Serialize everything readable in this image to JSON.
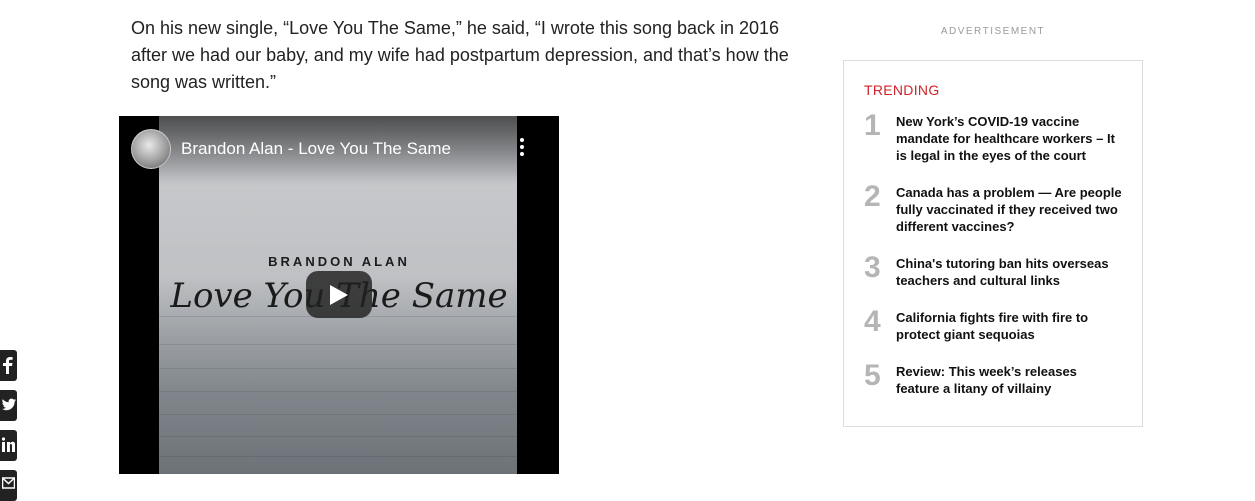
{
  "article": {
    "paragraph": "On his new single, “Love You The Same,” he said, “I wrote this song back in 2016 after we had our baby, and my wife had postpartum depression, and that’s how the song was written.”"
  },
  "video": {
    "title": "Brandon Alan - Love You The Same",
    "thumbnail_artist": "BRANDON ALAN",
    "thumbnail_song": "Love You The Same",
    "icons": {
      "menu": "kebab-menu-icon",
      "play": "play-icon"
    }
  },
  "share": {
    "items": [
      {
        "name": "facebook",
        "icon": "facebook-icon"
      },
      {
        "name": "twitter",
        "icon": "twitter-icon"
      },
      {
        "name": "linkedin",
        "icon": "linkedin-icon"
      },
      {
        "name": "email",
        "icon": "email-icon"
      }
    ]
  },
  "sidebar": {
    "ad_label": "ADVERTISEMENT",
    "trending_heading": "TRENDING",
    "trending": [
      {
        "num": "1",
        "title": "New York’s COVID-19 vaccine mandate for healthcare workers – It is legal in the eyes of the court"
      },
      {
        "num": "2",
        "title": "Canada has a problem — Are people fully vaccinated if they received two different vaccines?"
      },
      {
        "num": "3",
        "title": "China's tutoring ban hits overseas teachers and cultural links"
      },
      {
        "num": "4",
        "title": "California fights fire with fire to protect giant sequoias"
      },
      {
        "num": "5",
        "title": "Review: This week’s releases feature a litany of villainy"
      }
    ]
  },
  "colors": {
    "accent": "#d0232b",
    "text": "#222222",
    "muted_number": "#b5b5b5",
    "share_bg": "#222222"
  }
}
